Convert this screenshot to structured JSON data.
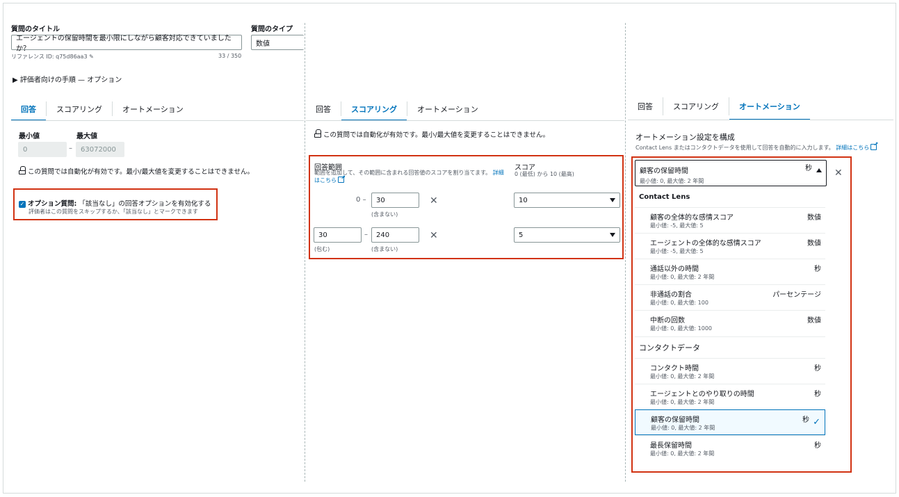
{
  "left": {
    "title_label": "質問のタイトル",
    "title_value": "エージェントの保留時間を最小限にしながら顧客対応できていましたか？",
    "reference_id": "リファレンス ID: q75d86aa3",
    "char_count": "33 / 350",
    "type_label": "質問のタイプ",
    "type_value": "数値",
    "instructions": "▶ 評価者向けの手順 — オプション",
    "tabs": [
      "回答",
      "スコアリング",
      "オートメーション"
    ],
    "min_label": "最小値",
    "max_label": "最大値",
    "min_value": "0",
    "dash": "–",
    "max_value": "63072000",
    "auto_note": "この質問では自動化が有効です。最小/最大値を変更することはできません。",
    "optional_bold": "オプション質問:",
    "optional_text": "「該当なし」の回答オプションを有効化する",
    "optional_sub": "評価者はこの質問をスキップするか、「該当なし」とマークできます"
  },
  "middle": {
    "tabs": [
      "回答",
      "スコアリング",
      "オートメーション"
    ],
    "auto_note": "この質問では自動化が有効です。最小/最大値を変更することはできません。",
    "range_label": "回答範囲",
    "range_desc": "範囲を追加して、その範囲に含まれる回答値のスコアを割り当てます。",
    "range_link_1": "詳細",
    "range_link_2": "はこちら",
    "score_label": "スコア",
    "score_desc": "0 (最低) から 10 (最高)",
    "row1": {
      "from": "0",
      "dash": "–",
      "to": "30",
      "to_note": "(含まない)",
      "score": "10"
    },
    "row2": {
      "from": "30",
      "from_note": "(包む)",
      "dash": "–",
      "to": "240",
      "to_note": "(含まない)",
      "score": "5"
    }
  },
  "right": {
    "tabs": [
      "回答",
      "スコアリング",
      "オートメーション"
    ],
    "config_title": "オートメーション設定を構成",
    "config_desc": "Contact Lens またはコンタクトデータを使用して回答を自動的に入力します。",
    "config_link": "詳細はこちら",
    "selected_name": "顧客の保留時間",
    "selected_range": "最小値: 0, 最大値: 2 年間",
    "selected_unit": "秒",
    "group_1": "Contact Lens",
    "group_1_items": [
      {
        "name": "顧客の全体的な感情スコア",
        "range": "最小値: -5, 最大値: 5",
        "unit": "数値"
      },
      {
        "name": "エージェントの全体的な感情スコア",
        "range": "最小値: -5, 最大値: 5",
        "unit": "数値"
      },
      {
        "name": "通話以外の時間",
        "range": "最小値: 0, 最大値: 2 年間",
        "unit": "秒"
      },
      {
        "name": "非通話の割合",
        "range": "最小値: 0, 最大値: 100",
        "unit": "パーセンテージ"
      },
      {
        "name": "中断の回数",
        "range": "最小値: 0, 最大値: 1000",
        "unit": "数値"
      }
    ],
    "group_2": "コンタクトデータ",
    "group_2_items": [
      {
        "name": "コンタクト時間",
        "range": "最小値: 0, 最大値: 2 年間",
        "unit": "秒"
      },
      {
        "name": "エージェントとのやり取りの時間",
        "range": "最小値: 0, 最大値: 2 年間",
        "unit": "秒"
      },
      {
        "name": "顧客の保留時間",
        "range": "最小値: 0, 最大値: 2 年間",
        "unit": "秒"
      },
      {
        "name": "最長保留時間",
        "range": "最小値: 0, 最大値: 2 年間",
        "unit": "秒"
      }
    ]
  },
  "colors": {
    "accent": "#0073bb",
    "highlight": "#d13212"
  }
}
